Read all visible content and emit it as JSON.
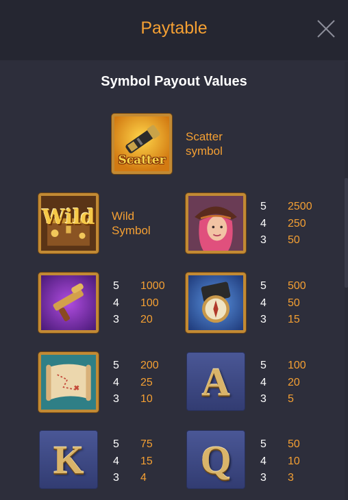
{
  "header": {
    "title": "Paytable"
  },
  "section_title": "Symbol Payout Values",
  "scatter": {
    "label_line1": "Scatter",
    "label_line2": "symbol",
    "icon_text": "Scatter"
  },
  "wild": {
    "label_line1": "Wild",
    "label_line2": "Symbol",
    "icon_text": "Wild"
  },
  "symbols": {
    "pirate_girl": {
      "payouts": [
        {
          "count": "5",
          "value": "2500"
        },
        {
          "count": "4",
          "value": "250"
        },
        {
          "count": "3",
          "value": "50"
        }
      ]
    },
    "gun": {
      "payouts": [
        {
          "count": "5",
          "value": "1000"
        },
        {
          "count": "4",
          "value": "100"
        },
        {
          "count": "3",
          "value": "20"
        }
      ]
    },
    "compass": {
      "payouts": [
        {
          "count": "5",
          "value": "500"
        },
        {
          "count": "4",
          "value": "50"
        },
        {
          "count": "3",
          "value": "15"
        }
      ]
    },
    "map": {
      "payouts": [
        {
          "count": "5",
          "value": "200"
        },
        {
          "count": "4",
          "value": "25"
        },
        {
          "count": "3",
          "value": "10"
        }
      ]
    },
    "a": {
      "letter": "A",
      "payouts": [
        {
          "count": "5",
          "value": "100"
        },
        {
          "count": "4",
          "value": "20"
        },
        {
          "count": "3",
          "value": "5"
        }
      ]
    },
    "k": {
      "letter": "K",
      "payouts": [
        {
          "count": "5",
          "value": "75"
        },
        {
          "count": "4",
          "value": "15"
        },
        {
          "count": "3",
          "value": "4"
        }
      ]
    },
    "q": {
      "letter": "Q",
      "payouts": [
        {
          "count": "5",
          "value": "50"
        },
        {
          "count": "4",
          "value": "10"
        },
        {
          "count": "3",
          "value": "3"
        }
      ]
    }
  },
  "colors": {
    "accent": "#f5a033",
    "background": "#2d2e3b",
    "header": "#252631"
  }
}
